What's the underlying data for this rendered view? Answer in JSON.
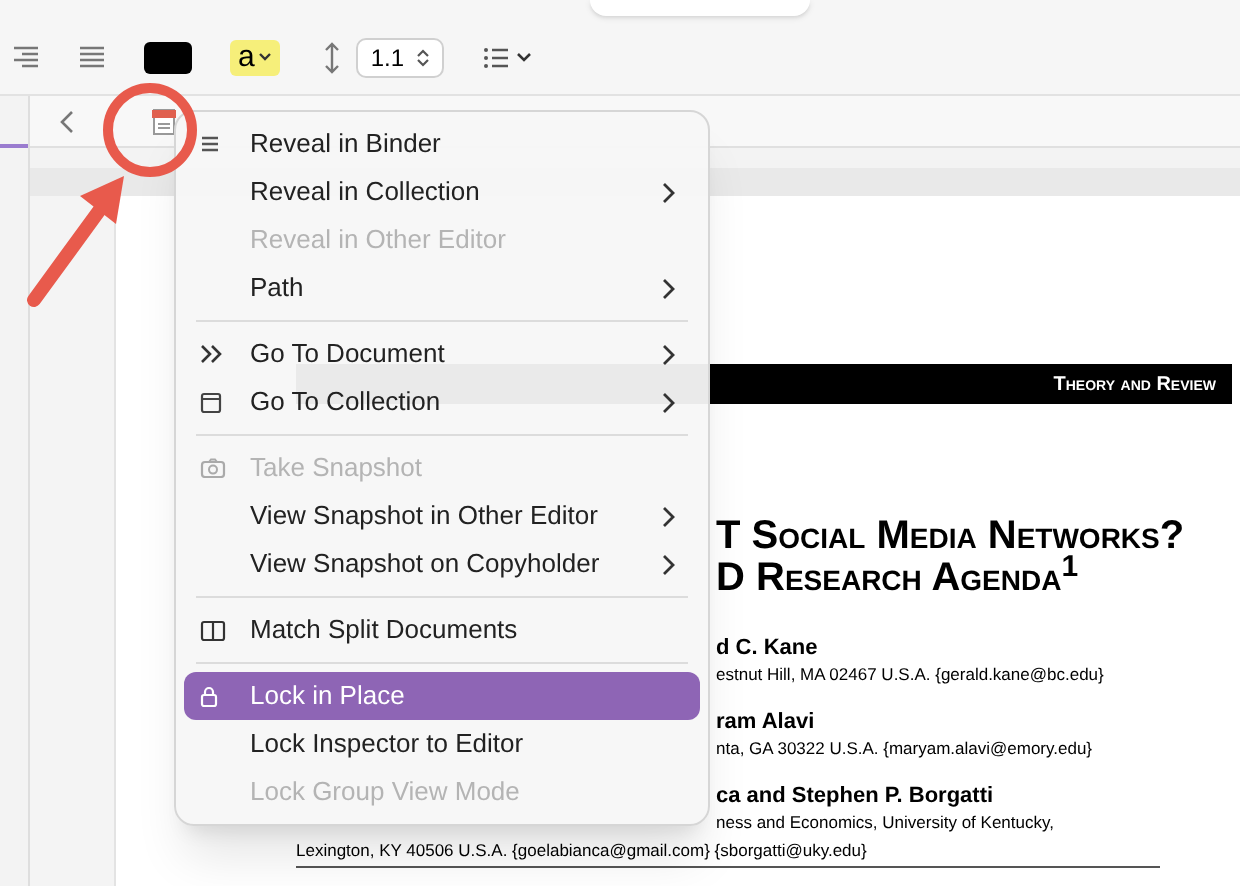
{
  "toolbar": {
    "highlight_label": "a",
    "line_spacing": "1.1"
  },
  "document": {
    "banner": "Theory and Review",
    "title_lines": [
      "T Social Media Networks?",
      "D Research Agenda$^{1}$"
    ],
    "authors": [
      {
        "name": "d C. Kane",
        "address_lines": [
          "estnut Hill, MA  02467  U.S.A.  {gerald.kane@bc.edu}"
        ]
      },
      {
        "name": "ram Alavi",
        "address_lines": [
          "nta, GA  30322  U.S.A.  {maryam.alavi@emory.edu}"
        ]
      },
      {
        "name": "ca and Stephen P. Borgatti",
        "address_lines": [
          "ness and Economics, University of Kentucky,",
          "Lexington, KY  40506  U.S.A.  {goelabianca@gmail.com}  {sborgatti@uky.edu}"
        ]
      }
    ]
  },
  "context_menu": {
    "items": [
      {
        "kind": "item",
        "label": "Reveal in Binder",
        "disabled": false,
        "submenu": false,
        "selected": false
      },
      {
        "kind": "item",
        "label": "Reveal in Collection",
        "disabled": false,
        "submenu": true,
        "selected": false
      },
      {
        "kind": "item",
        "label": "Reveal in Other Editor",
        "disabled": true,
        "submenu": false,
        "selected": false
      },
      {
        "kind": "item",
        "label": "Path",
        "disabled": false,
        "submenu": true,
        "selected": false
      },
      {
        "kind": "separator"
      },
      {
        "kind": "item",
        "label": "Go To Document",
        "disabled": false,
        "submenu": true,
        "selected": false
      },
      {
        "kind": "item",
        "label": "Go To Collection",
        "disabled": false,
        "submenu": true,
        "selected": false
      },
      {
        "kind": "separator"
      },
      {
        "kind": "item",
        "label": "Take Snapshot",
        "disabled": true,
        "submenu": false,
        "selected": false
      },
      {
        "kind": "item",
        "label": "View Snapshot in Other Editor",
        "disabled": false,
        "submenu": true,
        "selected": false
      },
      {
        "kind": "item",
        "label": "View Snapshot on Copyholder",
        "disabled": false,
        "submenu": true,
        "selected": false
      },
      {
        "kind": "separator"
      },
      {
        "kind": "item",
        "label": "Match Split Documents",
        "disabled": false,
        "submenu": false,
        "selected": false
      },
      {
        "kind": "separator"
      },
      {
        "kind": "item",
        "label": "Lock in Place",
        "disabled": false,
        "submenu": false,
        "selected": true
      },
      {
        "kind": "item",
        "label": "Lock Inspector to Editor",
        "disabled": false,
        "submenu": false,
        "selected": false
      },
      {
        "kind": "item",
        "label": "Lock Group View Mode",
        "disabled": true,
        "submenu": false,
        "selected": false
      }
    ]
  }
}
